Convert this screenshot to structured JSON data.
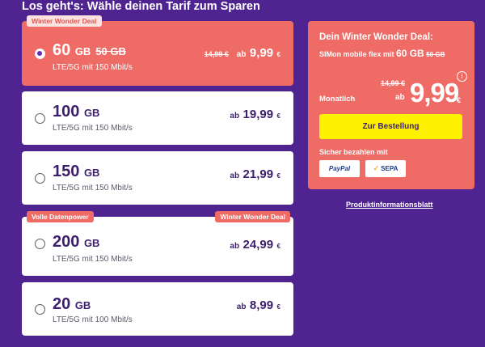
{
  "heading": "Los geht's: Wähle deinen Tarif zum Sparen",
  "plans": [
    {
      "tag_left": "Winter Wonder Deal",
      "gb": "60",
      "unit": "GB",
      "old_gb": "50 GB",
      "speed": "LTE/5G mit 150 Mbit/s",
      "old_price": "14,99 €",
      "ab": "ab",
      "price": "9,99",
      "currency": "€",
      "selected": true
    },
    {
      "gb": "100",
      "unit": "GB",
      "speed": "LTE/5G mit 150 Mbit/s",
      "ab": "ab",
      "price": "19,99",
      "currency": "€"
    },
    {
      "gb": "150",
      "unit": "GB",
      "speed": "LTE/5G mit 150 Mbit/s",
      "ab": "ab",
      "price": "21,99",
      "currency": "€"
    },
    {
      "tag_left": "Volle Datenpower",
      "tag_right": "Winter Wonder Deal",
      "gb": "200",
      "unit": "GB",
      "speed": "LTE/5G mit 150 Mbit/s",
      "ab": "ab",
      "price": "24,99",
      "currency": "€"
    },
    {
      "gb": "20",
      "unit": "GB",
      "speed": "LTE/5G mit 100 Mbit/s",
      "ab": "ab",
      "price": "8,99",
      "currency": "€"
    }
  ],
  "deal": {
    "title": "Dein Winter Wonder Deal:",
    "sub_prefix": "SIMon mobile flex mit",
    "sub_gb": "60 GB",
    "sub_old_gb": "50 GB",
    "info_icon": "i",
    "monthly": "Monatlich",
    "old_price": "14,99 €",
    "ab": "ab",
    "price": "9,99",
    "currency": "€",
    "order_button": "Zur Bestellung",
    "pay_label": "Sicher bezahlen mit",
    "paypal": "PayPal",
    "sepa": "SEPA",
    "sepa_icon": "✓"
  },
  "product_info_link": "Produktinformationsblatt",
  "colors": {
    "background": "#4f2491",
    "accent": "#ef6b66",
    "button": "#fff200",
    "text": "#3d1e6d"
  }
}
